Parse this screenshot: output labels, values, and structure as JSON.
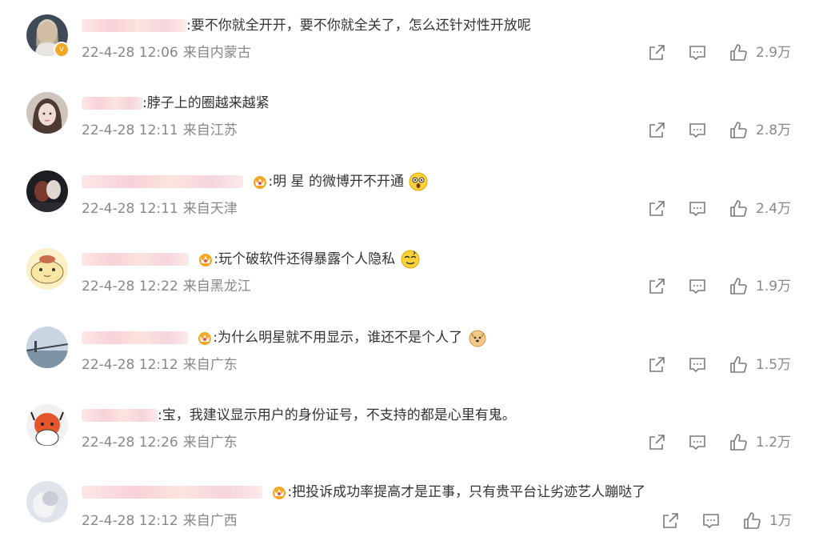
{
  "comments": [
    {
      "text": ":要不你就全开开，要不你就全关了，怎么还针对性开放呢",
      "date": "22-4-28 12:06",
      "location": "来自内蒙古",
      "likes": "2.9万",
      "crown": false,
      "emoji": "",
      "verified": true
    },
    {
      "text": ":脖子上的圈越来越紧",
      "date": "22-4-28 12:11",
      "location": "来自江苏",
      "likes": "2.8万",
      "crown": false,
      "emoji": "",
      "verified": false
    },
    {
      "text": ":明  星 的微博开不开通",
      "date": "22-4-28 12:11",
      "location": "来自天津",
      "likes": "2.4万",
      "crown": true,
      "emoji": "surprised-emoji",
      "verified": false
    },
    {
      "text": ":玩个破软件还得暴露个人隐私",
      "date": "22-4-28 12:22",
      "location": "来自黑龙江",
      "likes": "1.9万",
      "crown": true,
      "emoji": "dizzy-emoji",
      "verified": false
    },
    {
      "text": ":为什么明星就不用显示，谁还不是个人了",
      "date": "22-4-28 12:12",
      "location": "来自广东",
      "likes": "1.5万",
      "crown": true,
      "emoji": "doge-emoji",
      "verified": false
    },
    {
      "text": ":宝，我建议显示用户的身份证号，不支持的都是心里有鬼。",
      "date": "22-4-28 12:26",
      "location": "来自广东",
      "likes": "1.2万",
      "crown": false,
      "emoji": "",
      "verified": false
    },
    {
      "text": ":把投诉成功率提高才是正事，只有贵平台让劣迹艺人蹦哒了",
      "date": "22-4-28 12:12",
      "location": "来自广西",
      "likes": "1万",
      "crown": true,
      "emoji": "",
      "verified": false
    }
  ],
  "colors": {
    "text": "#333333",
    "meta": "#888888",
    "icon": "#7a7a7a",
    "crown": "#f5a623",
    "verified": "#f5a623"
  }
}
